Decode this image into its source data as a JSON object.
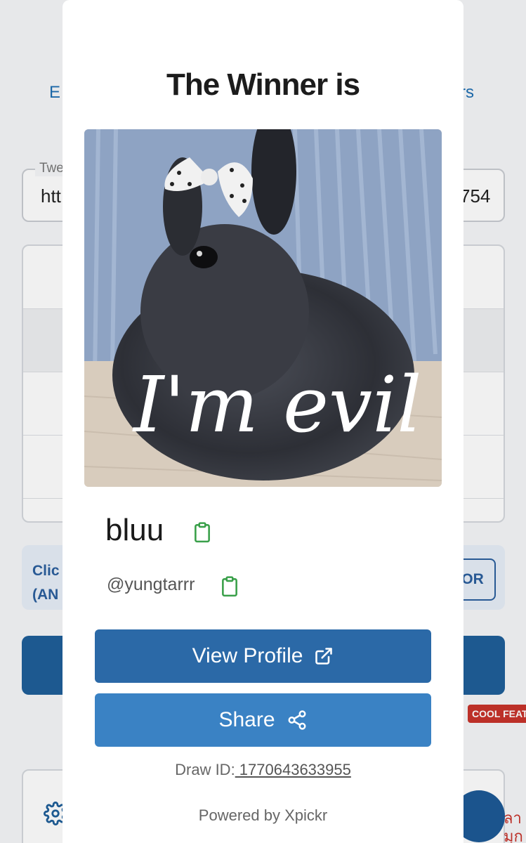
{
  "background": {
    "tab_left": "E",
    "tab_right": "rs",
    "input_label": "Twe",
    "input_value_start": "htt",
    "input_value_end": "754",
    "info_text_line1": "Clic",
    "info_text_line2": "(AN",
    "or_label": "OR",
    "badge_label": "COOL FEAT",
    "fab_text_line1": "ลา",
    "fab_text_line2": "มุก"
  },
  "modal": {
    "title": "The Winner is",
    "winner": {
      "image_caption": "I'm evil",
      "name": "bluu",
      "handle": "@yungtarrr"
    },
    "buttons": {
      "view_profile": "View Profile",
      "share": "Share"
    },
    "draw_id_label": "Draw ID:",
    "draw_id_value": " 1770643633955",
    "powered_by": "Powered by Xpickr"
  },
  "icons": {
    "copy": "clipboard-icon",
    "external": "external-link-icon",
    "share": "share-icon",
    "settings": "gear-icon"
  },
  "colors": {
    "primary_button": "#2b69a7",
    "secondary_button": "#3a82c4",
    "clipboard_icon": "#3aa04a",
    "badge": "#c8332b"
  }
}
